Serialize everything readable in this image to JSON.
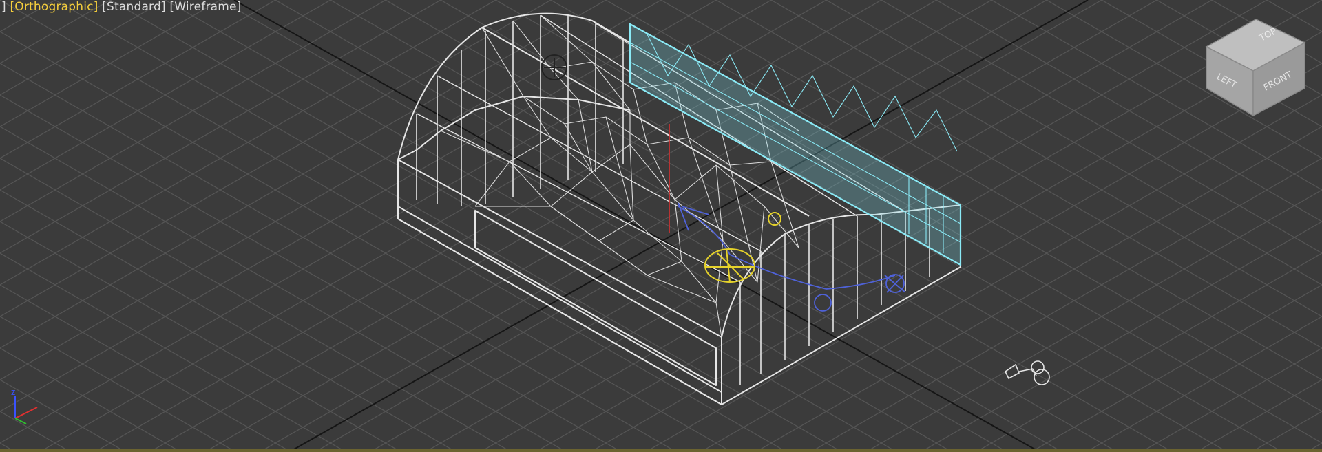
{
  "viewport": {
    "label": {
      "open_bracket": "]",
      "view_label": "[Orthographic]",
      "shading_label": "[Standard]",
      "mode_label": "[Wireframe]"
    },
    "viewcube": {
      "top": "TOP",
      "left": "LEFT",
      "front": "FRONT"
    }
  },
  "colors": {
    "background": "#3b3b3b",
    "grid": "#555555",
    "grid_major": "#111111",
    "wireframe": "#e8e8e8",
    "selected": "#7fe3f0",
    "helper_yellow": "#e5d22b",
    "helper_blue": "#4f62d9",
    "axis_red": "#d83030"
  }
}
